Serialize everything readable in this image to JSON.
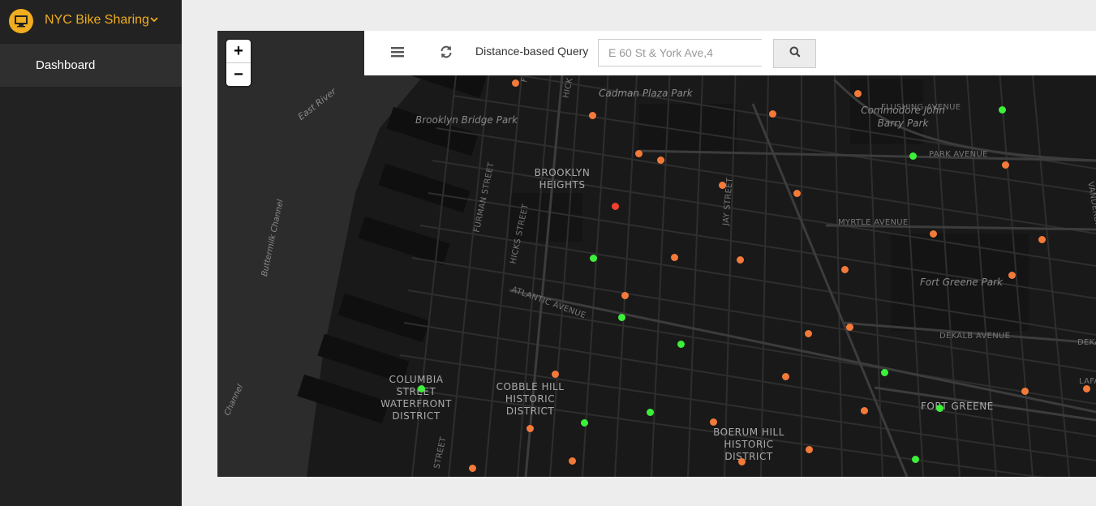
{
  "sidebar": {
    "brand_title": "NYC Bike Sharing",
    "brand_icon": "monitor-icon",
    "items": [
      {
        "label": "Dashboard"
      }
    ]
  },
  "toolbar": {
    "menu_icon": "hamburger-icon",
    "refresh_icon": "refresh-icon",
    "query_label": "Distance-based Query",
    "query_placeholder": "E 60 St & York Ave,4",
    "search_icon": "search-icon"
  },
  "map": {
    "zoom_in": "+",
    "zoom_out": "−",
    "place_labels": {
      "cadman": "Cadman Plaza Park",
      "brooklyn_bridge_park": "Brooklyn Bridge Park",
      "east_river": "East River",
      "buttermilk": "Buttermilk Channel",
      "channel": "Channel",
      "commodore": "Commodore John Barry Park",
      "brooklyn_heights": "BROOKLYN HEIGHTS",
      "fort_greene_park": "Fort Greene Park",
      "columbia": "COLUMBIA STREET WATERFRONT DISTRICT",
      "cobble_hill": "COBBLE HILL HISTORIC DISTRICT",
      "boerum_hill": "BOERUM HILL HISTORIC DISTRICT",
      "fort_greene": "FORT GREENE"
    },
    "street_labels": {
      "flushing": "FLUSHING AVENUE",
      "park": "PARK AVENUE",
      "myrtle": "MYRTLE AVENUE",
      "dekalb": "DEKALB AVENUE",
      "lafayette": "LAFAY",
      "dekalb2": "DEKAL",
      "atlantic": "ATLANTIC AVENUE",
      "furman": "FURMAN STREET",
      "hicks": "HICKS STREET",
      "jay": "JAY STREET",
      "vanderbilt": "VANDERBILT AVENUE",
      "hicks_top": "HICK",
      "henry": "STREET",
      "f": "F"
    },
    "colors": {
      "available": "#3cf03a",
      "low": "#f47a3a",
      "empty": "#f23f2e"
    }
  }
}
